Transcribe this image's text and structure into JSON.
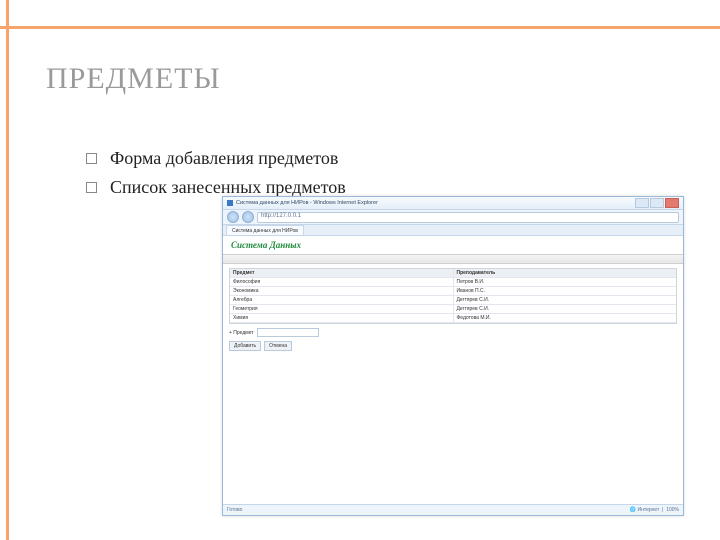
{
  "slide": {
    "title": "ПРЕДМЕТЫ",
    "bullets": [
      "Форма добавления предметов",
      "Список занесенных предметов"
    ]
  },
  "browser": {
    "window_title": "Система данных для НИРов - Windows Internet Explorer",
    "address": "http://127.0.0.1",
    "tab_title": "Система данных для НИРов",
    "site_heading": "Система Данных",
    "table": {
      "headers": [
        "Предмет",
        "Преподаватель"
      ],
      "rows": [
        [
          "Философия",
          "Петров В.И."
        ],
        [
          "Экономика",
          "Иванов П.С."
        ],
        [
          "Алгебра",
          "Дегтярев С.И."
        ],
        [
          "Геометрия",
          "Дегтярев С.И."
        ],
        [
          "Химия",
          "Федотова М.И."
        ]
      ]
    },
    "form": {
      "label": "+ Предмет",
      "submit": "Добавить",
      "cancel": "Отмена"
    },
    "status": {
      "left": "Готово",
      "net": "Интернет",
      "zoom": "100%"
    }
  }
}
